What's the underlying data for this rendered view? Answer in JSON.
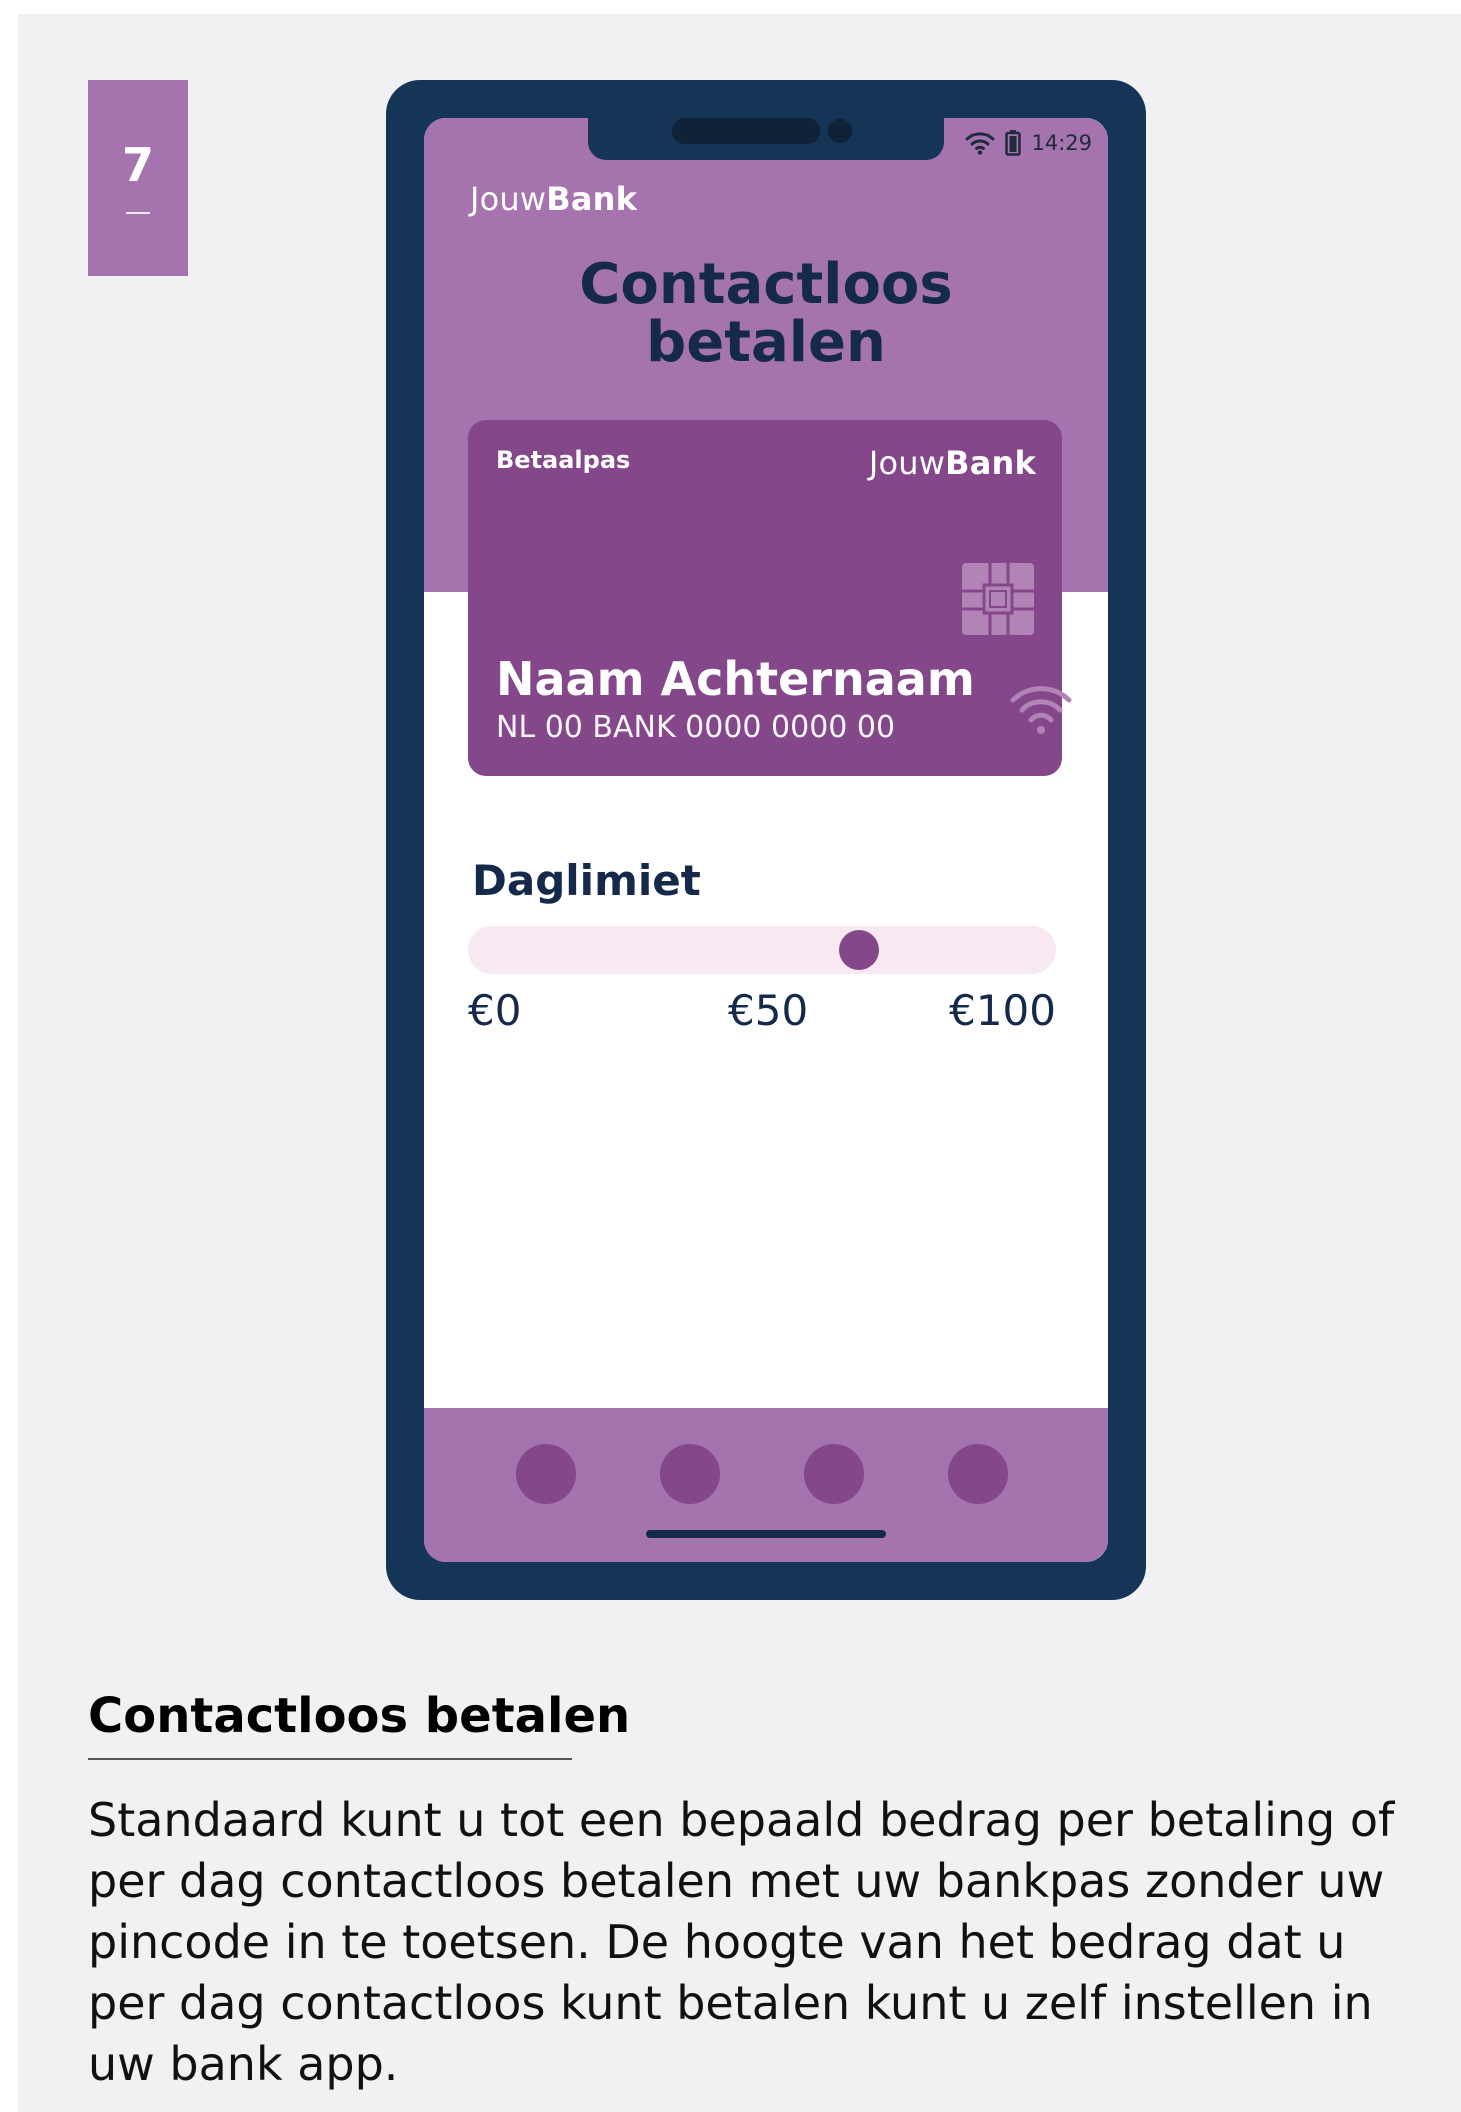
{
  "step": {
    "number": "7"
  },
  "status_bar": {
    "time": "14:29",
    "wifi_icon": "wifi-icon",
    "battery_icon": "battery-icon"
  },
  "app": {
    "brand_part1": "Jouw",
    "brand_part2": "Bank",
    "title_line1": "Contactloos",
    "title_line2": "betalen"
  },
  "card": {
    "type": "Betaalpas",
    "brand_part1": "Jouw",
    "brand_part2": "Bank",
    "holder_name": "Naam Achternaam",
    "iban": "NL 00 BANK 0000 0000 00"
  },
  "limit": {
    "label": "Daglimiet",
    "min_label": "€0",
    "mid_label": "€50",
    "max_label": "€100",
    "min": 0,
    "max": 100,
    "value": 68
  },
  "bottom_nav": {
    "count": 4
  },
  "caption": {
    "title": "Contactloos betalen",
    "body": "Standaard kunt u tot een bepaald bedrag per betaling of per dag contactloos betalen met uw bankpas zonder uw pincode in te toetsen. De hoogte van het bedrag dat u per dag contactloos kunt betalen kunt u zelf instellen in uw bank app."
  },
  "colors": {
    "accent_light": "#a573ad",
    "accent_dark": "#83478a",
    "phone_frame": "#143556",
    "slider_track": "#f7e8f2"
  }
}
